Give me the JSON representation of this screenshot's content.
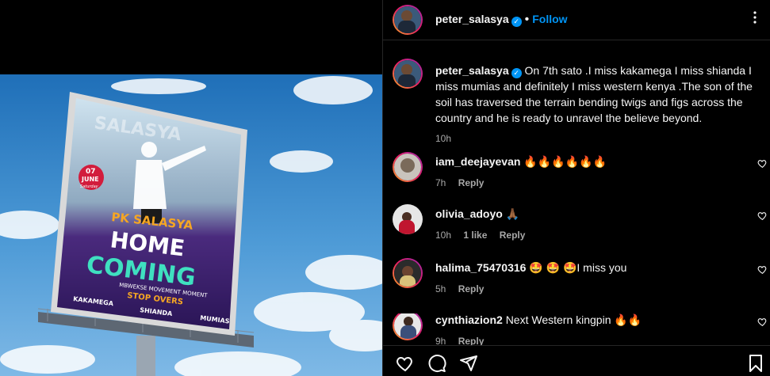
{
  "post": {
    "author": "peter_salasya",
    "follow_label": "Follow",
    "separator": "•",
    "more_icon": "more-horizontal-icon",
    "caption": "On 7th sato .I miss kakamega I miss shianda I miss mumias and definitely I miss western kenya .The son of the soil has traversed the terrain bending twigs and figs across the country and he is ready to unravel the believe beyond.",
    "time": "10h"
  },
  "billboard": {
    "watermark": "SALASYA",
    "date_day": "07",
    "date_month": "JUNE",
    "date_day_name": "Saturday",
    "name": "PK SALASYA",
    "headline1": "HOME",
    "headline2": "COMING",
    "movement": "MBWEKSE MOVEMENT MOMENT",
    "stop_overs": "STOP OVERS",
    "route1": "KAKAMEGA",
    "route2": "SHIANDA",
    "route3": "MUMIAS"
  },
  "comments": [
    {
      "user": "iam_deejayevan",
      "text": "🔥🔥🔥🔥🔥🔥",
      "time": "7h",
      "likes": "",
      "reply": "Reply"
    },
    {
      "user": "olivia_adoyo",
      "text": "🙏🏾",
      "time": "10h",
      "likes": "1 like",
      "reply": "Reply"
    },
    {
      "user": "halima_75470316",
      "text": "🤩 🤩 🤩I miss you",
      "time": "5h",
      "likes": "",
      "reply": "Reply"
    },
    {
      "user": "cynthiazion2",
      "text": "Next Western kingpin 🔥🔥",
      "time": "9h",
      "likes": "",
      "reply": "Reply"
    }
  ],
  "colors": {
    "accent": "#0095f6",
    "secondary_text": "#a8a8a8",
    "billboard_purple": "#3b1f6e",
    "billboard_teal": "#3fe0c0",
    "billboard_orange": "#f5a623"
  },
  "actions": {
    "like_icon": "heart-icon",
    "comment_icon": "comment-icon",
    "share_icon": "share-icon",
    "save_icon": "bookmark-icon"
  }
}
